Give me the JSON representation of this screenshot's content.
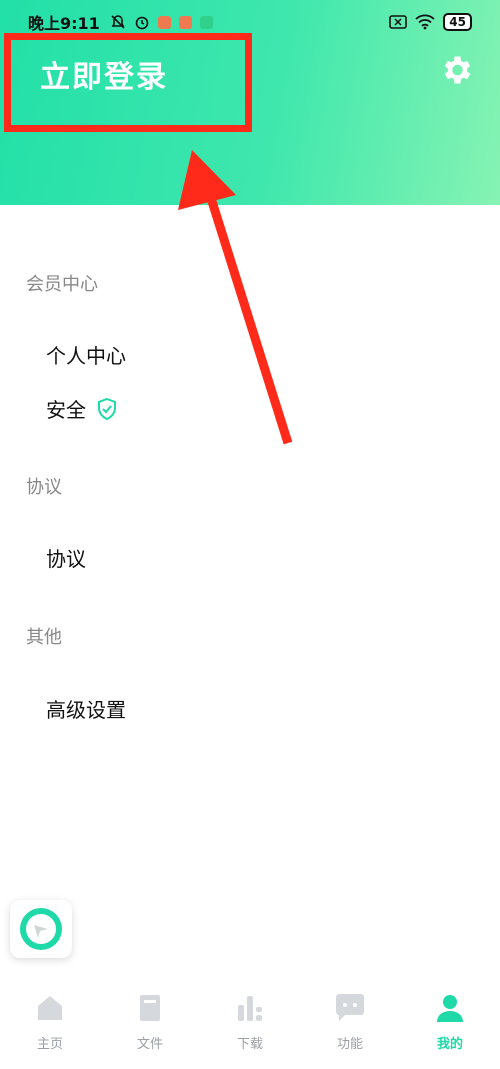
{
  "status_bar": {
    "time": "晚上9:11",
    "battery": "45"
  },
  "header": {
    "login_label": "立即登录"
  },
  "sections": {
    "member": {
      "title": "会员中心",
      "items": [
        "个人中心",
        "安全"
      ]
    },
    "agreement": {
      "title": "协议",
      "items": [
        "协议"
      ]
    },
    "other": {
      "title": "其他",
      "items": [
        "高级设置"
      ]
    }
  },
  "tabs": [
    {
      "label": "主页",
      "icon": "home-icon"
    },
    {
      "label": "文件",
      "icon": "book-icon"
    },
    {
      "label": "下载",
      "icon": "chart-icon"
    },
    {
      "label": "功能",
      "icon": "chat-icon"
    },
    {
      "label": "我的",
      "icon": "user-icon",
      "active": true
    }
  ],
  "colors": {
    "accent": "#1fd9a8",
    "header_start": "#22e0a8",
    "header_end": "#86f3b3",
    "annotation": "#ff2a1a"
  }
}
